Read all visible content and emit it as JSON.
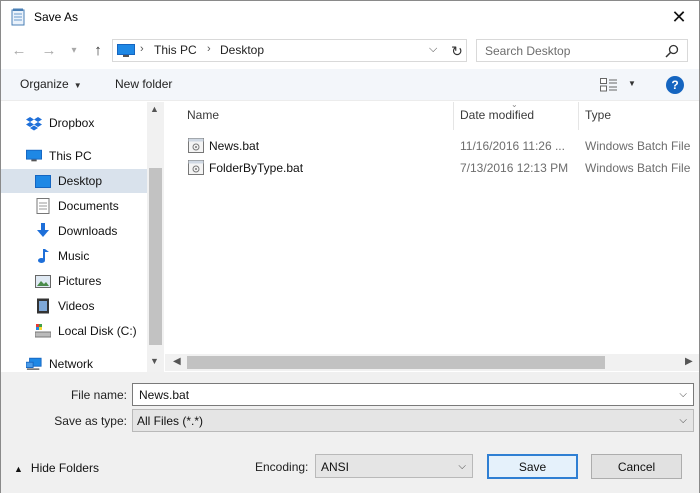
{
  "window": {
    "title": "Save As"
  },
  "address": {
    "crumbs": [
      "This PC",
      "Desktop"
    ]
  },
  "search": {
    "placeholder": "Search Desktop"
  },
  "toolbar": {
    "organize_label": "Organize",
    "new_folder_label": "New folder",
    "help_label": "?"
  },
  "nav": {
    "items": [
      {
        "label": "Dropbox",
        "icon": "dropbox-icon"
      },
      {
        "label": "This PC",
        "icon": "computer-icon"
      },
      {
        "label": "Desktop",
        "icon": "desktop-icon",
        "selected": true
      },
      {
        "label": "Documents",
        "icon": "documents-icon"
      },
      {
        "label": "Downloads",
        "icon": "downloads-icon"
      },
      {
        "label": "Music",
        "icon": "music-icon"
      },
      {
        "label": "Pictures",
        "icon": "pictures-icon"
      },
      {
        "label": "Videos",
        "icon": "videos-icon"
      },
      {
        "label": "Local Disk (C:)",
        "icon": "drive-icon"
      },
      {
        "label": "Network",
        "icon": "network-icon"
      }
    ]
  },
  "files": {
    "columns": [
      "Name",
      "Date modified",
      "Type"
    ],
    "rows": [
      {
        "name": "News.bat",
        "date": "11/16/2016 11:26 ...",
        "type": "Windows Batch File"
      },
      {
        "name": "FolderByType.bat",
        "date": "7/13/2016 12:13 PM",
        "type": "Windows Batch File"
      }
    ]
  },
  "form": {
    "file_name_label": "File name:",
    "file_name_value": "News.bat",
    "save_type_label": "Save as type:",
    "save_type_value": "All Files  (*.*)",
    "encoding_label": "Encoding:",
    "encoding_value": "ANSI",
    "hide_folders_label": "Hide Folders",
    "save_label": "Save",
    "cancel_label": "Cancel"
  },
  "colors": {
    "accent": "#2f7fd3",
    "selection": "#d9e2ec",
    "help": "#1565c0"
  }
}
